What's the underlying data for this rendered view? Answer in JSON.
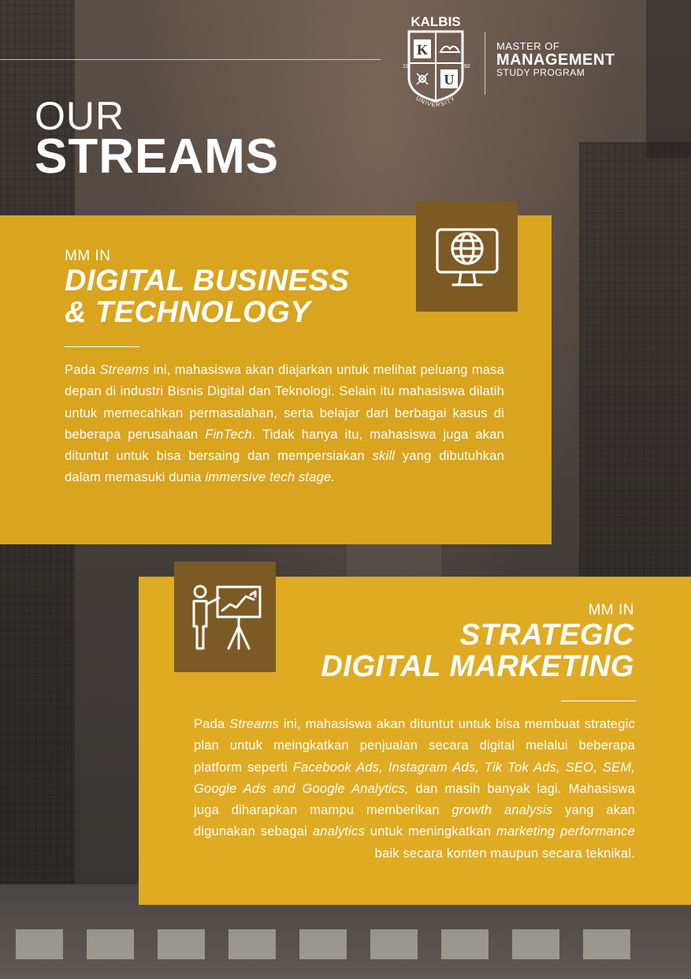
{
  "logo": {
    "name": "KALBIS",
    "year_left": "19",
    "year_right": "92",
    "letter_k": "K",
    "letter_u": "U",
    "arc_text": "UNIVERSITY"
  },
  "program": {
    "line1": "MASTER OF",
    "line2": "MANAGEMENT",
    "line3": "STUDY PROGRAM"
  },
  "heading": {
    "line1": "OUR",
    "line2": "STREAMS"
  },
  "stream1": {
    "prefix": "MM IN",
    "title_line1": "DIGITAL BUSINESS",
    "title_line2": "& TECHNOLOGY",
    "icon": "globe-monitor-icon",
    "body": [
      {
        "t": "Pada "
      },
      {
        "t": "Streams",
        "i": true
      },
      {
        "t": " ini, mahasiswa akan diajarkan untuk melihat peluang masa depan di industri Bisnis Digital dan Teknologi. Selain itu mahasiswa dilatih untuk memecahkan permasalahan, serta belajar dari berbagai kasus di beberapa perusahaan "
      },
      {
        "t": "FinTech",
        "i": true
      },
      {
        "t": ". Tidak hanya itu, mahasiswa juga akan dituntut untuk bisa bersaing dan mempersiakan "
      },
      {
        "t": "skill",
        "i": true
      },
      {
        "t": " yang dibutuhkan dalam memasuki dunia "
      },
      {
        "t": "immersive tech stage.",
        "i": true
      }
    ]
  },
  "stream2": {
    "prefix": "MM IN",
    "title_line1": "STRATEGIC",
    "title_line2": "DIGITAL MARKETING",
    "icon": "presenter-chart-icon",
    "body": [
      {
        "t": "Pada "
      },
      {
        "t": "Streams",
        "i": true
      },
      {
        "t": " ini, mahasiswa akan dituntut untuk bisa membuat strategic plan untuk meingkatkan penjualan secara digital melalui beberapa platform seperti "
      },
      {
        "t": "Facebook Ads, Instagram Ads, Tik Tok Ads, SEO, SEM, Google Ads and Google Analytics,",
        "i": true
      },
      {
        "t": " dan masih banyak lagi. Mahasiswa juga diharapkan mampu memberikan "
      },
      {
        "t": "growth analysis",
        "i": true
      },
      {
        "t": " yang akan digunakan sebagai "
      },
      {
        "t": "analytics",
        "i": true
      },
      {
        "t": " untuk meningkatkan "
      },
      {
        "t": "marketing performance",
        "i": true
      },
      {
        "t": " baik secara konten maupun secara teknikal."
      }
    ]
  },
  "colors": {
    "card1": "#d9a41e",
    "card2": "#dfab23",
    "icon_box": "#7c5a24"
  }
}
